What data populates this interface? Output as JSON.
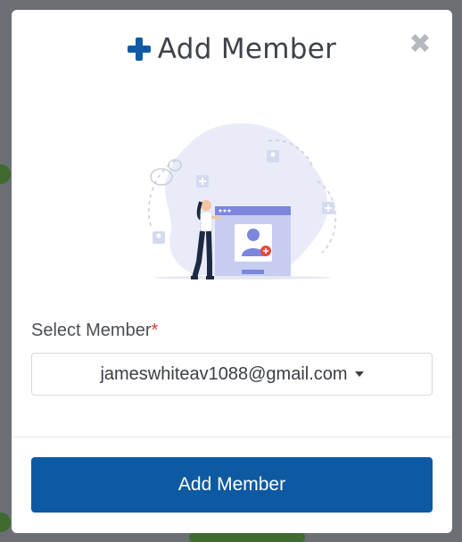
{
  "modal": {
    "title": "Add Member",
    "close_icon": "close-icon",
    "title_icon": "plus-icon",
    "illustration": "add-user-illustration"
  },
  "form": {
    "label": "Select Member",
    "required_marker": "*",
    "selected_value": "jameswhiteav1088@gmail.com"
  },
  "actions": {
    "submit_label": "Add Member"
  },
  "colors": {
    "primary": "#0d5aa2",
    "required": "#e03b3b",
    "overlay": "#6b6f74"
  }
}
